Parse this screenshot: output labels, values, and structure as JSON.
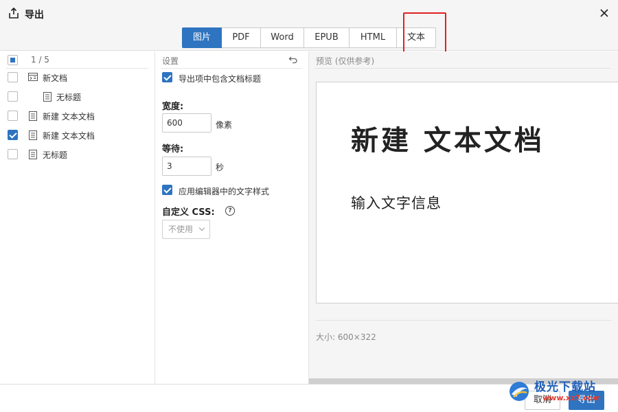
{
  "dialog": {
    "title": "导出",
    "tabs": [
      {
        "label": "图片",
        "active": true
      },
      {
        "label": "PDF",
        "active": false
      },
      {
        "label": "Word",
        "active": false
      },
      {
        "label": "EPUB",
        "active": false
      },
      {
        "label": "HTML",
        "active": false
      },
      {
        "label": "文本",
        "active": false
      }
    ]
  },
  "doc_list": {
    "count": "1 / 5",
    "items": [
      {
        "label": "新文档",
        "icon": "folder-doc-icon",
        "checked": false
      },
      {
        "label": "无标题",
        "icon": "document-icon",
        "checked": false
      },
      {
        "label": "新建 文本文档",
        "icon": "document-icon",
        "checked": false
      },
      {
        "label": "新建 文本文档",
        "icon": "document-icon",
        "checked": true
      },
      {
        "label": "无标题",
        "icon": "document-icon",
        "checked": false
      }
    ]
  },
  "settings": {
    "label": "设置",
    "include_title": "导出项中包含文档标题",
    "width_label": "宽度:",
    "width_value": "600",
    "width_unit": "像素",
    "wait_label": "等待:",
    "wait_value": "3",
    "wait_unit": "秒",
    "apply_styles": "应用编辑器中的文字样式",
    "css_label": "自定义 CSS:",
    "css_select": "不使用"
  },
  "preview": {
    "label": "预览 (仅供参考)",
    "doc_title": "新建 文本文档",
    "doc_body": "输入文字信息",
    "size": "大小: 600×322"
  },
  "footer": {
    "cancel": "取消",
    "export": "导出"
  },
  "watermark": {
    "title": "极光下载站",
    "url": "www.xz7.com"
  },
  "colors": {
    "accent": "#2e74c0",
    "highlight": "#e02020",
    "watermark_blue": "#1f5fb8",
    "watermark_red": "#e23b2e"
  }
}
